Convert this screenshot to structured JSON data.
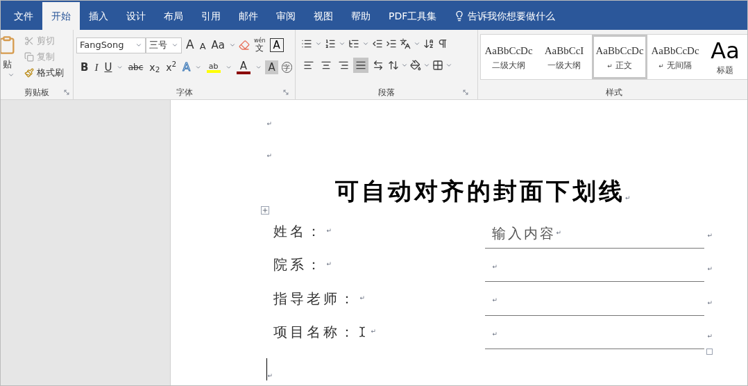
{
  "tabs": [
    {
      "label": "文件",
      "selected": false
    },
    {
      "label": "开始",
      "selected": true
    },
    {
      "label": "插入",
      "selected": false
    },
    {
      "label": "设计",
      "selected": false
    },
    {
      "label": "布局",
      "selected": false
    },
    {
      "label": "引用",
      "selected": false
    },
    {
      "label": "邮件",
      "selected": false
    },
    {
      "label": "审阅",
      "selected": false
    },
    {
      "label": "视图",
      "selected": false
    },
    {
      "label": "帮助",
      "selected": false
    },
    {
      "label": "PDF工具集",
      "selected": false
    }
  ],
  "tell_me": "告诉我你想要做什么",
  "clipboard": {
    "paste": "贴",
    "items": [
      {
        "kind": "cut",
        "label": "剪切",
        "disabled": true
      },
      {
        "kind": "copy",
        "label": "复制",
        "disabled": true
      },
      {
        "kind": "painter",
        "label": "格式刷",
        "disabled": false
      }
    ],
    "group_label": "剪贴板"
  },
  "font": {
    "name": "FangSong",
    "size": "三号",
    "group_label": "字体",
    "row1": [
      {
        "kind": "grow",
        "text": "A"
      },
      {
        "kind": "shrink",
        "text": "A"
      },
      {
        "kind": "case",
        "text": "Aa"
      },
      {
        "kind": "clear"
      },
      {
        "kind": "phonetic",
        "text": "文",
        "ruby": "wén"
      },
      {
        "kind": "border",
        "text": "A"
      }
    ],
    "row2": [
      {
        "kind": "bold",
        "text": "B"
      },
      {
        "kind": "italic",
        "text": "I"
      },
      {
        "kind": "underline",
        "text": "U"
      },
      {
        "kind": "strike",
        "text": "abc"
      },
      {
        "kind": "script",
        "text": "x$_{2}$"
      },
      {
        "kind": "script",
        "text": "x$^{2}$"
      },
      {
        "kind": "effect",
        "text": "A"
      },
      {
        "kind": "highlight",
        "text": "ab",
        "color": "#ffff00"
      },
      {
        "kind": "fontcolor",
        "text": "A",
        "color": "#8b0000"
      },
      {
        "kind": "shading",
        "text": "A"
      },
      {
        "kind": "enclose",
        "text": "字"
      }
    ]
  },
  "paragraph": {
    "group_label": "段落",
    "row1": [
      {
        "kind": "bullets"
      },
      {
        "kind": "numbering"
      },
      {
        "kind": "multilevel"
      },
      {
        "kind": "outdent"
      },
      {
        "kind": "indent"
      },
      {
        "kind": "chinese"
      },
      {
        "kind": "sort"
      },
      {
        "kind": "marks"
      }
    ],
    "alignment": [
      {
        "kind": "left",
        "selected": false
      },
      {
        "kind": "center",
        "selected": false
      },
      {
        "kind": "right",
        "selected": false
      },
      {
        "kind": "justify",
        "selected": true
      },
      {
        "kind": "distributed",
        "selected": false
      }
    ],
    "row2": [
      {
        "kind": "spacing"
      },
      {
        "kind": "fill"
      },
      {
        "kind": "borders"
      }
    ]
  },
  "styles": {
    "group_label": "样式",
    "items": [
      {
        "kind": "plain",
        "preview": "AaBbCcDc",
        "name": "二级大纲",
        "selected": false
      },
      {
        "kind": "plain",
        "preview": "AaBbCcI",
        "name": "一级大纲",
        "selected": false
      },
      {
        "kind": "plain",
        "preview": "AaBbCcDc",
        "name": "正文",
        "mark": "↵",
        "selected": true
      },
      {
        "kind": "plain",
        "preview": "AaBbCcDc",
        "name": "无间隔",
        "mark": "↵",
        "selected": false
      },
      {
        "kind": "title",
        "preview": "Aa",
        "name": "标题",
        "selected": false
      }
    ]
  },
  "document": {
    "empty_lines": [
      "↵",
      "↵"
    ],
    "title": "可自动对齐的封面下划线",
    "title_mark": "↵",
    "rows": [
      {
        "label": "姓名：",
        "label_mark": "↵",
        "value": "输入内容",
        "value_mark": "↵",
        "end_mark": "↵"
      },
      {
        "label": "院系：",
        "label_mark": "↵",
        "value_mark": "↵",
        "end_mark": "↵"
      },
      {
        "label": "指导老师：",
        "label_mark": "↵",
        "value_mark": "↵",
        "end_mark": "↵"
      },
      {
        "label": "项目名称：",
        "label_mark": "↵",
        "value_mark": "↵",
        "end_mark": "↵",
        "pointer": true
      }
    ],
    "last_line_mark": "↵"
  }
}
